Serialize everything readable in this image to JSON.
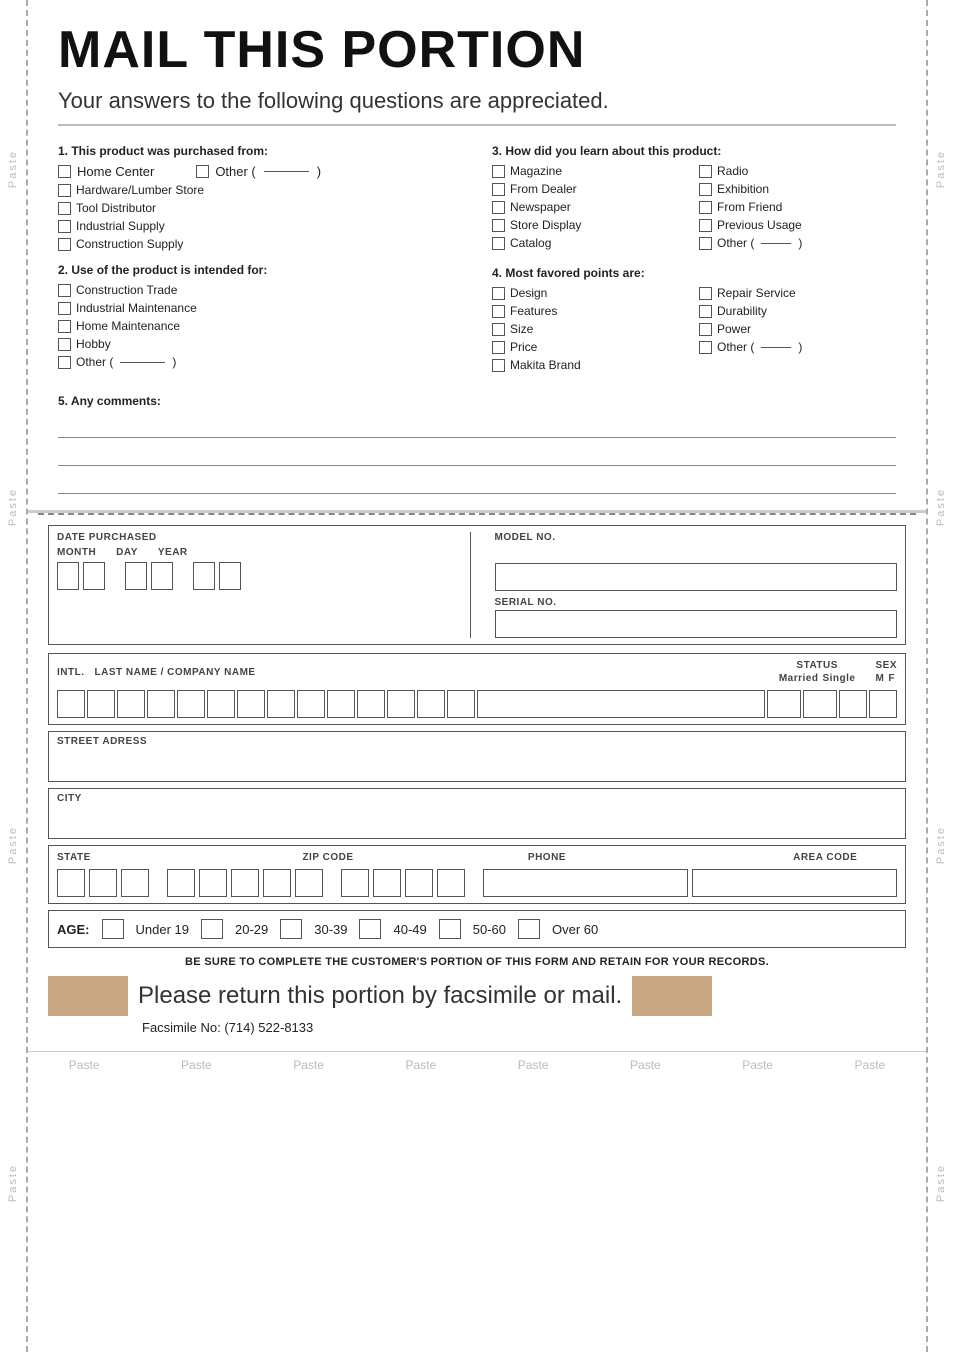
{
  "page": {
    "title": "MAIL THIS PORTION",
    "subtitle": "Your answers to the following questions are appreciated.",
    "q1": {
      "label": "1. This product was purchased from:",
      "options": [
        {
          "text": "Home Center"
        },
        {
          "text": "Other (",
          "has_paren": true
        },
        {
          "text": "Hardware/Lumber Store"
        },
        {
          "text": "Tool Distributor"
        },
        {
          "text": "Industrial Supply"
        },
        {
          "text": "Construction Supply"
        }
      ]
    },
    "q2": {
      "label": "2. Use of the product is intended for:",
      "options": [
        {
          "text": "Construction Trade"
        },
        {
          "text": "Industrial Maintenance"
        },
        {
          "text": "Home Maintenance"
        },
        {
          "text": "Hobby"
        },
        {
          "text": "Other (",
          "has_paren": true
        }
      ]
    },
    "q3": {
      "label": "3. How did you learn about this product:",
      "options_col1": [
        {
          "text": "Magazine"
        },
        {
          "text": "From Dealer"
        },
        {
          "text": "Newspaper"
        },
        {
          "text": "Store Display"
        },
        {
          "text": "Catalog"
        }
      ],
      "options_col2": [
        {
          "text": "Radio"
        },
        {
          "text": "Exhibition"
        },
        {
          "text": "From Friend"
        },
        {
          "text": "Previous Usage"
        },
        {
          "text": "Other (",
          "has_paren": true
        }
      ]
    },
    "q4": {
      "label": "4. Most favored points are:",
      "options_col1": [
        {
          "text": "Design"
        },
        {
          "text": "Features"
        },
        {
          "text": "Size"
        },
        {
          "text": "Price"
        },
        {
          "text": "Makita Brand"
        }
      ],
      "options_col2": [
        {
          "text": "Repair Service"
        },
        {
          "text": "Durability"
        },
        {
          "text": "Power"
        },
        {
          "text": "Other (",
          "has_paren": true
        }
      ]
    },
    "q5": {
      "label": "5. Any comments:"
    },
    "form": {
      "date_purchased": "DATE PURCHASED",
      "month": "MONTH",
      "day": "DAY",
      "year": "YEAR",
      "model_no": "MODEL NO.",
      "serial_no": "SERIAL NO.",
      "intl": "INTL.",
      "last_name": "LAST NAME / COMPANY NAME",
      "status": "STATUS",
      "married": "Married",
      "single": "Single",
      "sex": "SEX",
      "m": "M",
      "f": "F",
      "street": "STREET ADRESS",
      "city": "CITY",
      "state": "STATE",
      "zip_code": "ZIP CODE",
      "phone": "PHONE",
      "area_code": "AREA CODE",
      "age_label": "AGE:",
      "age_options": [
        "Under 19",
        "20-29",
        "30-39",
        "40-49",
        "50-60",
        "Over 60"
      ],
      "retain_notice": "BE SURE TO COMPLETE THE CUSTOMER'S PORTION OF THIS FORM AND RETAIN FOR YOUR RECORDS.",
      "return_text": "Please return this portion by facsimile or mail.",
      "fax_text": "Facsimile No: (714) 522-8133"
    },
    "paste_labels": [
      "Paste",
      "Paste",
      "Paste",
      "Paste",
      "Paste",
      "Paste",
      "Paste",
      "Paste"
    ]
  }
}
